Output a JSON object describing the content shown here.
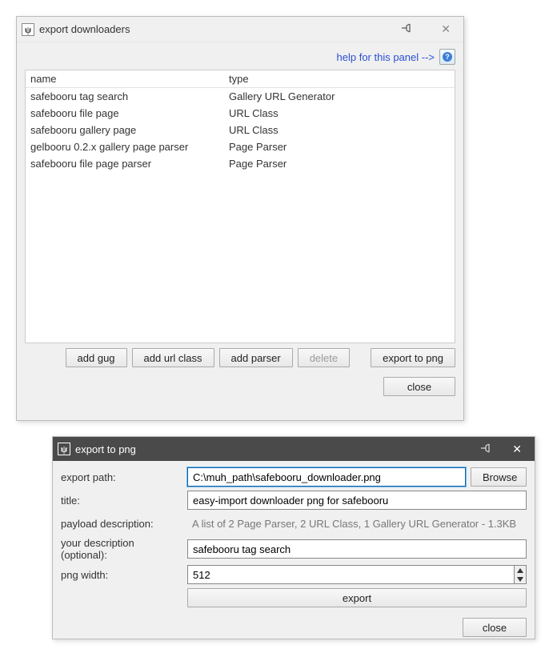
{
  "window1": {
    "title": "export downloaders",
    "help_link": "help for this panel -->",
    "table": {
      "headers": {
        "name": "name",
        "type": "type"
      },
      "rows": [
        {
          "name": "safebooru tag search",
          "type": "Gallery URL Generator"
        },
        {
          "name": "safebooru file page",
          "type": "URL Class"
        },
        {
          "name": "safebooru gallery page",
          "type": "URL Class"
        },
        {
          "name": "gelbooru 0.2.x gallery page parser",
          "type": "Page Parser"
        },
        {
          "name": "safebooru file page parser",
          "type": "Page Parser"
        }
      ]
    },
    "buttons": {
      "add_gug": "add gug",
      "add_url_class": "add url class",
      "add_parser": "add parser",
      "delete": "delete",
      "export_to_png": "export to png",
      "close": "close"
    }
  },
  "window2": {
    "title": "export to png",
    "labels": {
      "export_path": "export path:",
      "title": "title:",
      "payload_description": "payload description:",
      "your_description": "your description (optional):",
      "png_width": "png width:"
    },
    "fields": {
      "export_path": "C:\\muh_path\\safebooru_downloader.png",
      "title": "easy-import downloader png for safebooru",
      "payload_description": "A list of 2 Page Parser, 2 URL Class, 1 Gallery URL Generator - 1.3KB",
      "your_description": "safebooru tag search",
      "png_width": "512"
    },
    "buttons": {
      "browse": "Browse",
      "export": "export",
      "close": "close"
    }
  }
}
